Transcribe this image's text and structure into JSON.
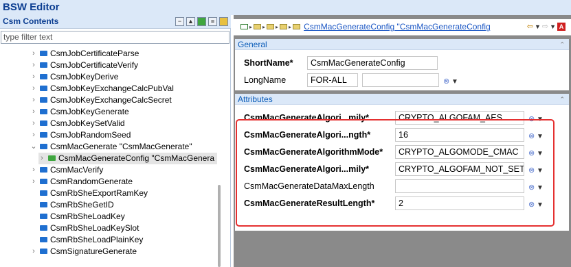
{
  "app": {
    "title": "BSW Editor"
  },
  "left_panel": {
    "title": "Csm Contents",
    "tools": [
      "collapse-all-icon",
      "filter-icon",
      "green-export-icon",
      "document-icon",
      "grid-icon"
    ],
    "filter_placeholder": "type filter text",
    "tree": [
      {
        "label": "CsmJobCertificateParse",
        "twisty": "›"
      },
      {
        "label": "CsmJobCertificateVerify",
        "twisty": "›"
      },
      {
        "label": "CsmJobKeyDerive",
        "twisty": "›"
      },
      {
        "label": "CsmJobKeyExchangeCalcPubVal",
        "twisty": "›"
      },
      {
        "label": "CsmJobKeyExchangeCalcSecret",
        "twisty": "›"
      },
      {
        "label": "CsmJobKeyGenerate",
        "twisty": "›"
      },
      {
        "label": "CsmJobKeySetValid",
        "twisty": "›"
      },
      {
        "label": "CsmJobRandomSeed",
        "twisty": "›"
      },
      {
        "label": "CsmMacGenerate \"CsmMacGenerate\"",
        "twisty": "⌄"
      },
      {
        "label": "CsmMacGenerateConfig \"CsmMacGenera",
        "twisty": "›"
      },
      {
        "label": "CsmMacVerify",
        "twisty": "›"
      },
      {
        "label": "CsmRandomGenerate",
        "twisty": "›"
      },
      {
        "label": "CsmRbSheExportRamKey",
        "twisty": ""
      },
      {
        "label": "CsmRbSheGetID",
        "twisty": ""
      },
      {
        "label": "CsmRbSheLoadKey",
        "twisty": ""
      },
      {
        "label": "CsmRbSheLoadKeySlot",
        "twisty": ""
      },
      {
        "label": "CsmRbSheLoadPlainKey",
        "twisty": ""
      },
      {
        "label": "CsmSignatureGenerate",
        "twisty": "›"
      }
    ]
  },
  "breadcrumb": {
    "link": "CsmMacGenerateConfig \"CsmMacGenerateConfig"
  },
  "general": {
    "title": "General",
    "shortname_label": "ShortName*",
    "shortname_value": "CsmMacGenerateConfig",
    "longname_label": "LongName",
    "longname_lang": "FOR-ALL",
    "longname_value": ""
  },
  "attributes": {
    "title": "Attributes",
    "rows": [
      {
        "label": "CsmMacGenerateAlgori...mily*",
        "value": "CRYPTO_ALGOFAM_AES",
        "bold": true,
        "gray": false
      },
      {
        "label": "CsmMacGenerateAlgori...ngth*",
        "value": "16",
        "bold": true,
        "gray": false
      },
      {
        "label": "CsmMacGenerateAlgorithmMode*",
        "value": "CRYPTO_ALGOMODE_CMAC",
        "bold": true,
        "gray": false
      },
      {
        "label": "CsmMacGenerateAlgori...mily*",
        "value": "CRYPTO_ALGOFAM_NOT_SET",
        "bold": true,
        "gray": false
      },
      {
        "label": "CsmMacGenerateDataMaxLength",
        "value": "",
        "bold": false,
        "gray": false
      },
      {
        "label": "CsmMacGenerateResultLength*",
        "value": "2",
        "bold": true,
        "gray": false
      }
    ]
  },
  "colors": {
    "accent": "#0b3d91",
    "highlight": "#e53030",
    "header_bg": "#dbe8f8"
  }
}
